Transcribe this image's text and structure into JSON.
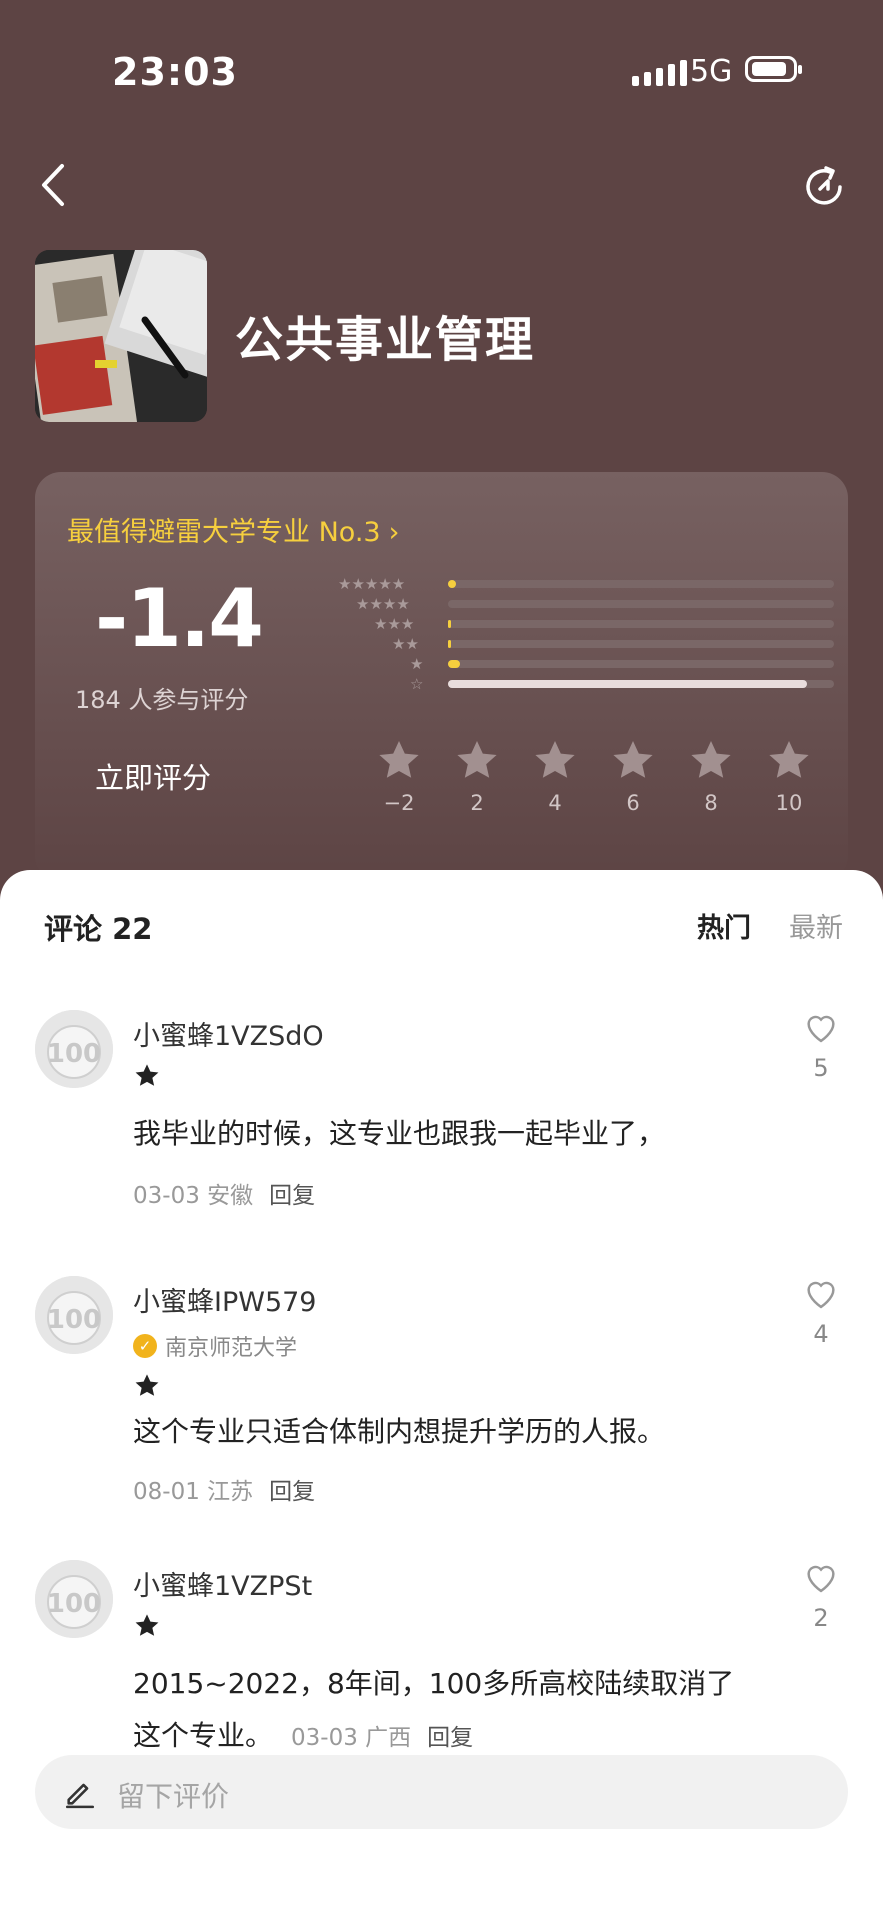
{
  "status": {
    "time": "23:03",
    "network": "5G"
  },
  "major": {
    "title": "公共事业管理"
  },
  "rating": {
    "rank_label": "最值得避雷大学专业 No.3",
    "score": "-1.4",
    "participants": "184 人参与评分",
    "rate_now": "立即评分",
    "distribution": [
      {
        "stars": 5,
        "fraction": 0.02
      },
      {
        "stars": 4,
        "fraction": 0.0
      },
      {
        "stars": 3,
        "fraction": 0.005
      },
      {
        "stars": 2,
        "fraction": 0.005
      },
      {
        "stars": 1,
        "fraction": 0.03
      },
      {
        "stars": 0,
        "fraction": 0.93
      }
    ],
    "scale": [
      "−2",
      "2",
      "4",
      "6",
      "8",
      "10"
    ],
    "accent": "#f6cf3e"
  },
  "comments_section": {
    "header": "评论 22",
    "tab_hot": "热门",
    "tab_new": "最新",
    "items": [
      {
        "user": "小蜜蜂1VZSdO",
        "text": "我毕业的时候，这专业也跟我一起毕业了，",
        "date": "03-03 安徽",
        "reply": "回复",
        "likes": "5"
      },
      {
        "user": "小蜜蜂IPW579",
        "university": "南京师范大学",
        "text": "这个专业只适合体制内想提升学历的人报。",
        "date": "08-01 江苏",
        "reply": "回复",
        "likes": "4"
      },
      {
        "user": "小蜜蜂1VZPSt",
        "text": "2015~2022，8年间，100多所高校陆续取消了这个专业。",
        "date": "03-03 广西",
        "reply": "回复",
        "likes": "2"
      }
    ]
  },
  "input": {
    "placeholder": "留下评价"
  }
}
